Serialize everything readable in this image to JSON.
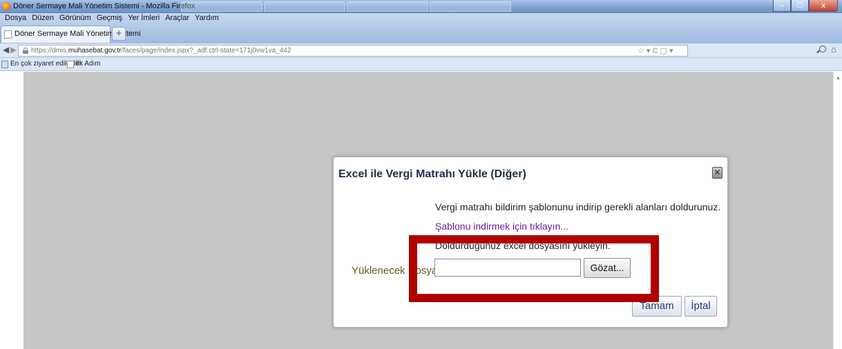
{
  "window": {
    "title": "Döner Sermaye Mali Yönetim Sistemi - Mozilla Firefox",
    "minimize": "–",
    "maximize": "☐",
    "close": "x"
  },
  "menu": {
    "items": [
      "Dosya",
      "Düzen",
      "Görünüm",
      "Geçmiş",
      "Yer İmleri",
      "Araçlar",
      "Yardım"
    ]
  },
  "tabs": {
    "active_label": "Döner Sermaye Mali Yönetim Sistemi",
    "new_tab": "+"
  },
  "nav": {
    "back": "◀",
    "forward": "▶",
    "url_prefix": "https://dmis.",
    "url_domain": "muhasebat.gov.tr",
    "url_path": "/faces/page/index.jspx?_adf.ctrl-state=171j0vw1va_442",
    "url_actions": "☆ ▾ C  ▢ ▾",
    "home": "⌂"
  },
  "bookmarks": {
    "items": [
      "En çok ziyaret edilenler",
      "İlk Adım"
    ]
  },
  "dialog": {
    "title": "Excel ile Vergi Matrahı Yükle (Diğer)",
    "close": "✕",
    "line1": "Vergi matrahı bildirim şablonunu indirip gerekli alanları doldurunuz.",
    "template_link": "Şablonu indirmek için tıklayın...",
    "line3": "Doldurduğunuz excel dosyasını yükleyin.",
    "file_label": "Yüklenecek Dosya:",
    "browse_button": "Gözat...",
    "ok_button": "Tamam",
    "cancel_button": "İptal"
  },
  "colors": {
    "highlight_border": "#b00000",
    "overlay": "#c6c6c6",
    "link": "#6a1b9a"
  }
}
